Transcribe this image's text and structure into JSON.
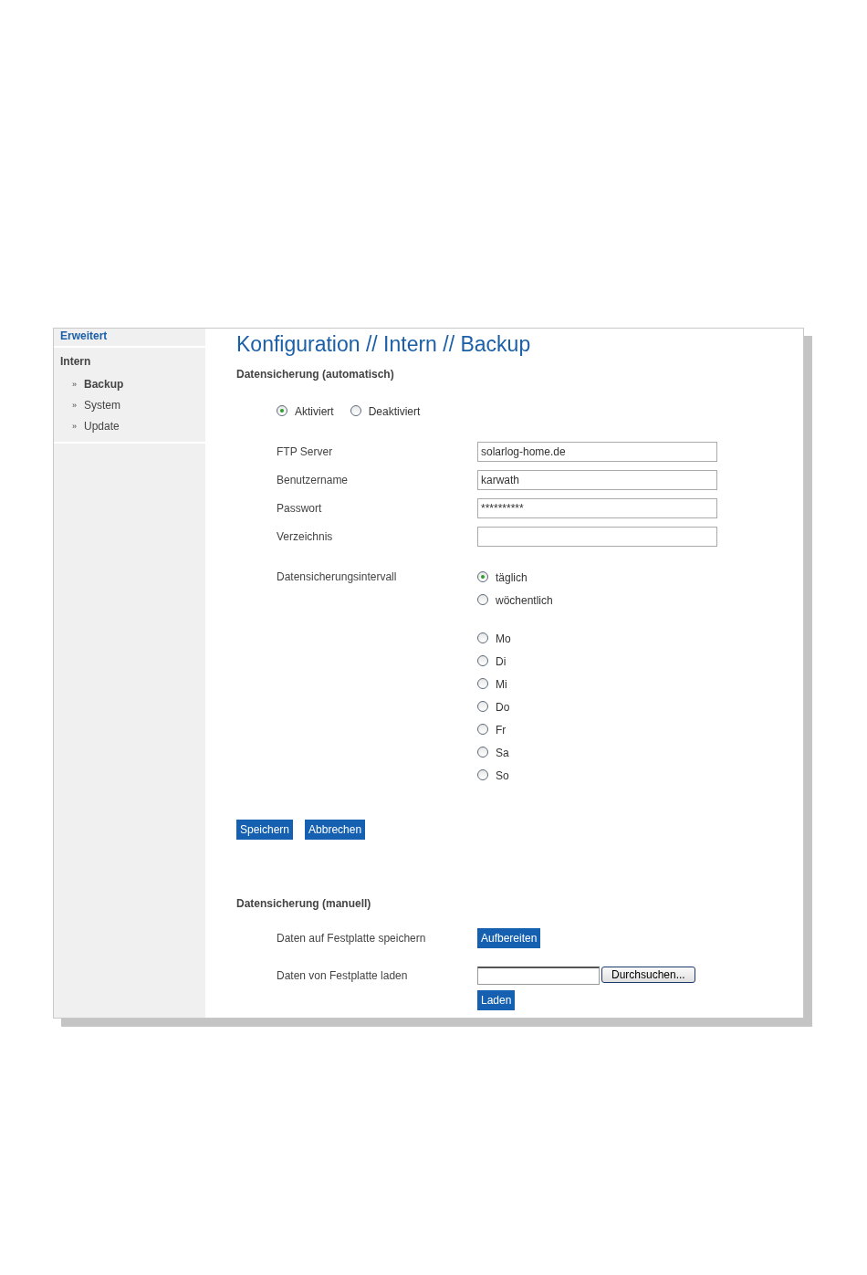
{
  "sidebar": {
    "header": "Erweitert",
    "section": "Intern",
    "items": [
      {
        "bullet": "»",
        "label": "Backup",
        "selected": true
      },
      {
        "bullet": "»",
        "label": "System",
        "selected": false
      },
      {
        "bullet": "»",
        "label": "Update",
        "selected": false
      }
    ]
  },
  "title": "Konfiguration // Intern // Backup",
  "auto": {
    "heading": "Datensicherung (automatisch)",
    "mode": [
      {
        "label": "Aktiviert",
        "selected": true
      },
      {
        "label": "Deaktiviert",
        "selected": false
      }
    ],
    "fields": [
      {
        "label": "FTP Server",
        "value": "solarlog-home.de"
      },
      {
        "label": "Benutzername",
        "value": "karwath"
      },
      {
        "label": "Passwort",
        "value": "**********"
      },
      {
        "label": "Verzeichnis"
      }
    ],
    "interval_label": "Datensicherungsintervall",
    "interval": [
      {
        "label": "täglich",
        "selected": true
      },
      {
        "label": "wöchentlich",
        "selected": false
      }
    ],
    "days": [
      {
        "label": "Mo",
        "selected": false
      },
      {
        "label": "Di",
        "selected": false
      },
      {
        "label": "Mi",
        "selected": false
      },
      {
        "label": "Do",
        "selected": false
      },
      {
        "label": "Fr",
        "selected": false
      },
      {
        "label": "Sa",
        "selected": false
      },
      {
        "label": "So",
        "selected": false
      }
    ],
    "buttons": [
      "Speichern",
      "Abbrechen"
    ]
  },
  "manual": {
    "heading": "Datensicherung (manuell)",
    "save_label": "Daten auf Festplatte speichern",
    "save_button": "Aufbereiten",
    "load_label": "Daten von Festplatte laden",
    "browse_button": "Durchsuchen...",
    "load_button": "Laden"
  }
}
